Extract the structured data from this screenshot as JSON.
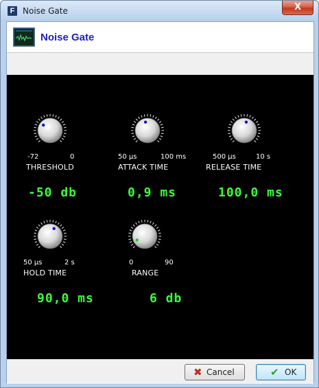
{
  "window": {
    "title": "Noise Gate",
    "app_icon_letter": "F",
    "close_glyph": "X"
  },
  "header": {
    "title": "Noise Gate",
    "icon": "waveform-icon"
  },
  "colors": {
    "panel_bg": "#000000",
    "readout": "#39ff39",
    "header_title": "#1e1ec8",
    "indicator_blue": "#1010d8",
    "indicator_green": "#22cc22"
  },
  "knobs": [
    {
      "label": "THRESHOLD",
      "min": "-72",
      "max": "0",
      "readout": "-50 db",
      "level": 0.31,
      "indicator": "blue"
    },
    {
      "label": "ATTACK TIME",
      "min": "50 µs",
      "max": "100 ms",
      "readout": "0,9 ms",
      "level": 0.45,
      "indicator": "blue"
    },
    {
      "label": "RELEASE TIME",
      "min": "500 µs",
      "max": "10 s",
      "readout": "100,0 ms",
      "level": 0.55,
      "indicator": "blue"
    },
    {
      "label": "HOLD TIME",
      "min": "50 µs",
      "max": "2 s",
      "readout": "90,0 ms",
      "level": 0.6,
      "indicator": "blue"
    },
    {
      "label": "RANGE",
      "min": "0",
      "max": "90",
      "readout": "6 db",
      "level": 0.07,
      "indicator": "green"
    }
  ],
  "footer": {
    "cancel_label": "Cancel",
    "ok_label": "OK"
  }
}
